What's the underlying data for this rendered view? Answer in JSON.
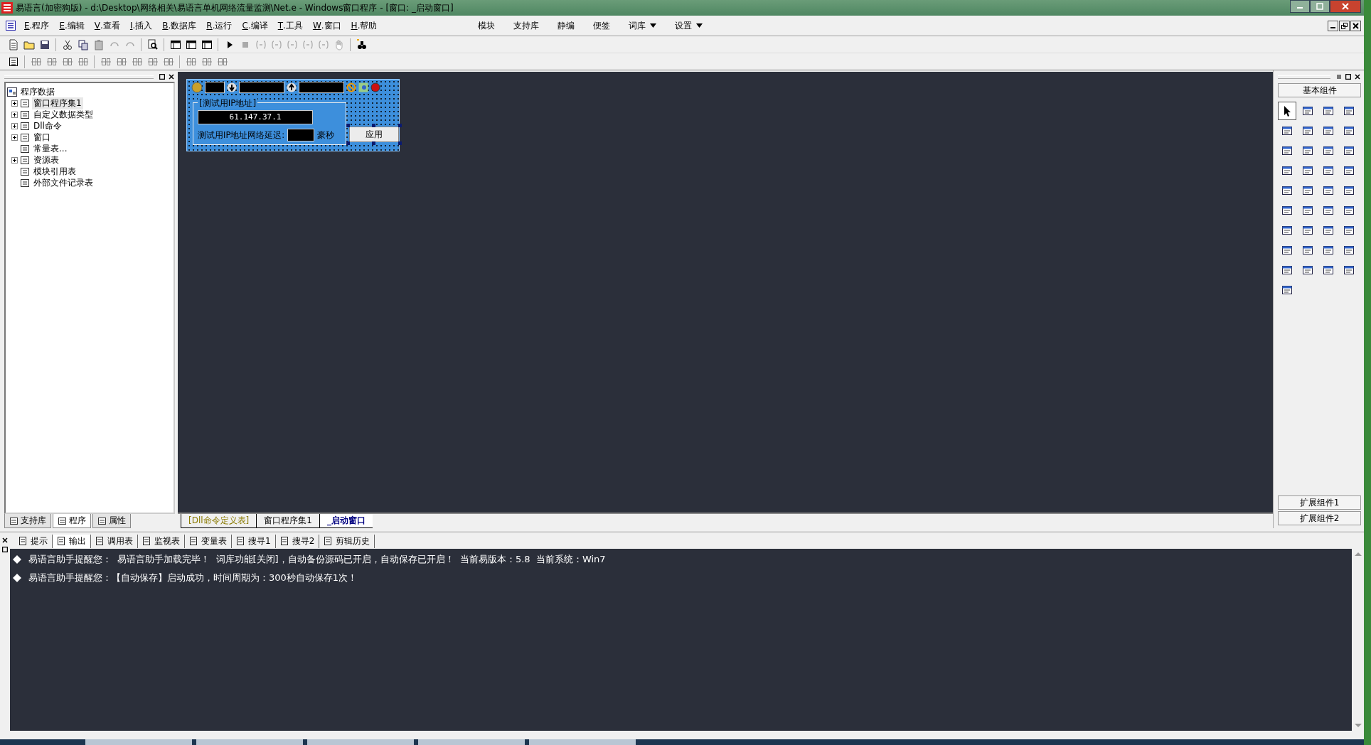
{
  "window": {
    "title": "易语言(加密狗版) - d:\\Desktop\\网络相关\\易语言单机网络流量监测\\Net.e - Windows窗口程序 - [窗口: _启动窗口]"
  },
  "menu": [
    {
      "key": "E",
      "label": ".程序"
    },
    {
      "key": "E",
      "label": ".编辑"
    },
    {
      "key": "V",
      "label": ".查看"
    },
    {
      "key": "I",
      "label": ".插入"
    },
    {
      "key": "B",
      "label": ".数据库"
    },
    {
      "key": "R",
      "label": ".运行"
    },
    {
      "key": "C",
      "label": ".编译"
    },
    {
      "key": "T",
      "label": ".工具"
    },
    {
      "key": "W",
      "label": ".窗口"
    },
    {
      "key": "H",
      "label": ".帮助"
    }
  ],
  "extra_menu": [
    {
      "label": "模块",
      "dropdown": false
    },
    {
      "label": "支持库",
      "dropdown": false
    },
    {
      "label": "静编",
      "dropdown": false
    },
    {
      "label": "便签",
      "dropdown": false
    },
    {
      "label": "词库",
      "dropdown": true
    },
    {
      "label": "设置",
      "dropdown": true
    }
  ],
  "tree": {
    "label": "程序数据",
    "children": [
      {
        "label": "窗口程序集1",
        "collapsed": true,
        "selected": true
      },
      {
        "label": "自定义数据类型",
        "collapsed": true,
        "selected": false
      },
      {
        "label": "Dll命令",
        "collapsed": true,
        "selected": false
      },
      {
        "label": "窗口",
        "collapsed": true,
        "selected": false
      },
      {
        "label": "常量表...",
        "collapsed": false,
        "selected": false
      },
      {
        "label": "资源表",
        "collapsed": true,
        "selected": false
      },
      {
        "label": "模块引用表",
        "collapsed": false,
        "selected": false
      },
      {
        "label": "外部文件记录表",
        "collapsed": false,
        "selected": false
      }
    ]
  },
  "left_tabs": [
    {
      "label": "支持库",
      "selected": false
    },
    {
      "label": "程序",
      "selected": true
    },
    {
      "label": "属性",
      "selected": false
    }
  ],
  "designer": {
    "group_title": "[测试用IP地址]",
    "ip_value": "61.147.37.1",
    "delay_label": "测试用IP地址网络延迟:",
    "unit": "豪秒",
    "apply_button": "应用"
  },
  "editor_tabs": [
    {
      "label": "[Dll命令定义表]",
      "kind": "table",
      "selected": false
    },
    {
      "label": "窗口程序集1",
      "kind": "code",
      "selected": false
    },
    {
      "label": "_启动窗口",
      "kind": "window",
      "selected": true
    }
  ],
  "palette": {
    "title": "基本组件",
    "extensions": [
      "扩展组件1",
      "扩展组件2"
    ]
  },
  "output_tabs": [
    {
      "label": "提示",
      "selected": false
    },
    {
      "label": "输出",
      "selected": true
    },
    {
      "label": "调用表",
      "selected": false
    },
    {
      "label": "监视表",
      "selected": false
    },
    {
      "label": "变量表",
      "selected": false
    },
    {
      "label": "搜寻1",
      "selected": false
    },
    {
      "label": "搜寻2",
      "selected": false
    },
    {
      "label": "剪辑历史",
      "selected": false
    }
  ],
  "messages": [
    "易语言助手提醒您：  易语言助手加载完毕！  词库功能[关闭]，自动备份源码已开启，自动保存已开启！  当前易版本：5.8  当前系统：Win7",
    "易语言助手提醒您：【自动保存】启动成功，时间周期为：300秒自动保存1次！"
  ]
}
